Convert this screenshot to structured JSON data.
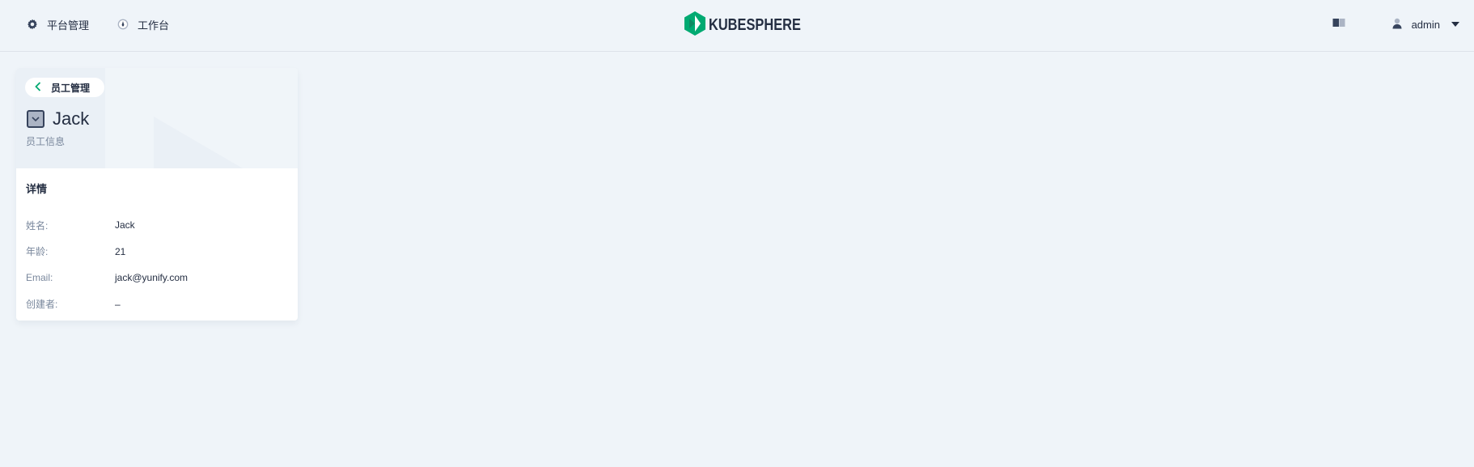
{
  "nav": {
    "platform_label": "平台管理",
    "workbench_label": "工作台",
    "logo_text": "KUBESPHERE",
    "user_name": "admin"
  },
  "card": {
    "back_label": "员工管理",
    "title": "Jack",
    "subtitle": "员工信息",
    "section_title": "详情",
    "details": [
      {
        "key": "姓名:",
        "value": "Jack"
      },
      {
        "key": "年龄:",
        "value": "21"
      },
      {
        "key": "Email:",
        "value": "jack@yunify.com"
      },
      {
        "key": "创建者:",
        "value": "–"
      }
    ]
  },
  "colors": {
    "background": "#eff4f9",
    "logo_green": "#00aa72",
    "text_primary": "#242e42",
    "text_secondary": "#79879c"
  }
}
